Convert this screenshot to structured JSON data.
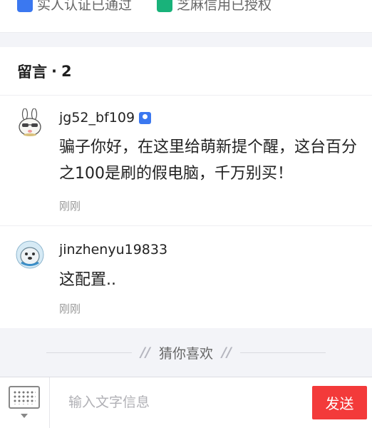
{
  "verification": {
    "items": [
      {
        "label": "实人认证已通过",
        "icon": "id-verified-icon",
        "color": "#3b78f0"
      },
      {
        "label": "芝麻信用已授权",
        "icon": "sesame-credit-icon",
        "color": "#19b27a"
      }
    ]
  },
  "comments": {
    "title": "留言",
    "separator": "·",
    "count": "2",
    "items": [
      {
        "username": "jg52_bf109",
        "verified": true,
        "avatar": "rabbit-avatar",
        "content": "骗子你好，在这里给萌新提个醒，这台百分之100是刷的假电脑，千万别买！",
        "time": "刚刚"
      },
      {
        "username": "jinzhenyu19833",
        "verified": false,
        "avatar": "seal-avatar",
        "content": "这配置..",
        "time": "刚刚"
      }
    ]
  },
  "guess": {
    "title": "猜你喜欢",
    "decor": "//"
  },
  "bottom_bar": {
    "input_placeholder": "输入文字信息",
    "send_label": "发送",
    "keyboard_icon": "keyboard-icon"
  },
  "colors": {
    "accent_red": "#f33a3a",
    "verify_blue": "#3b78f0",
    "verify_green": "#19b27a"
  }
}
